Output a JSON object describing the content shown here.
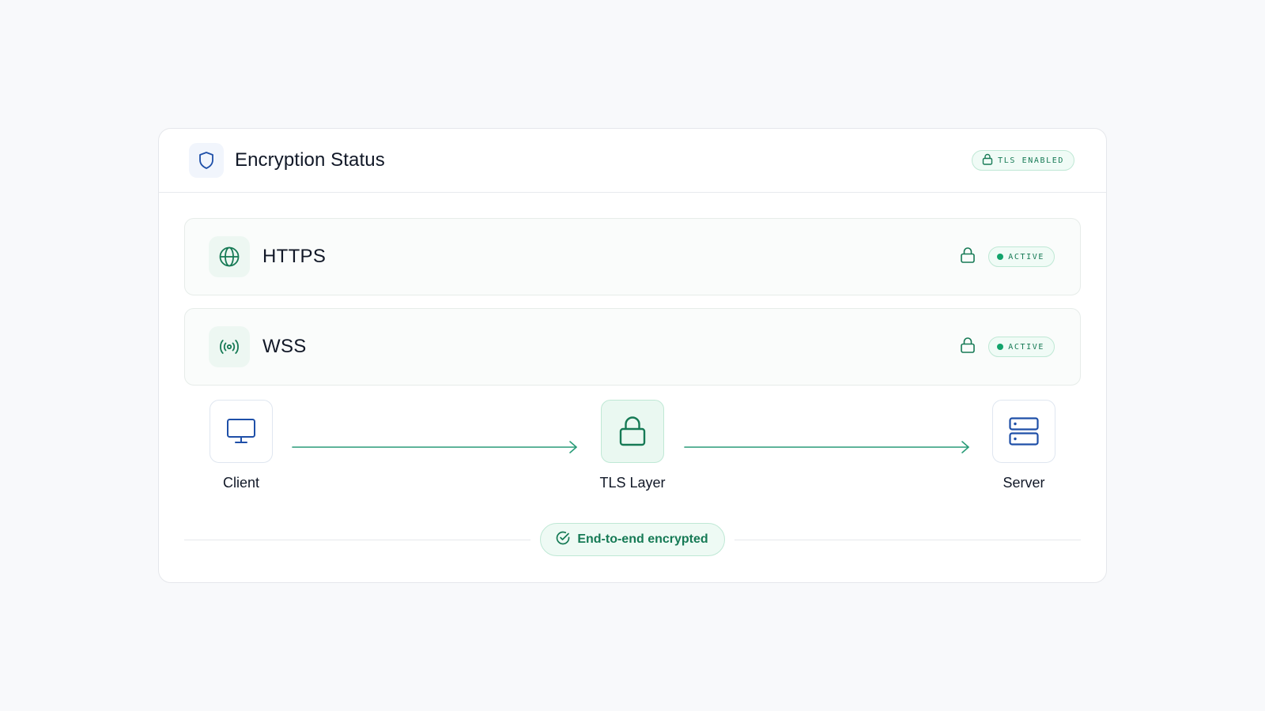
{
  "header": {
    "title": "Encryption Status",
    "icon": "shield-icon",
    "badge": {
      "label": "TLS ENABLED",
      "icon": "lock-icon"
    }
  },
  "protocols": [
    {
      "name": "HTTPS",
      "icon": "globe-icon",
      "status": "ACTIVE",
      "status_icon": "lock-icon"
    },
    {
      "name": "WSS",
      "icon": "broadcast-icon",
      "status": "ACTIVE",
      "status_icon": "lock-icon"
    }
  ],
  "flow": {
    "nodes": [
      {
        "label": "Client",
        "icon": "monitor-icon"
      },
      {
        "label": "TLS Layer",
        "icon": "lock-icon"
      },
      {
        "label": "Server",
        "icon": "server-icon"
      }
    ]
  },
  "footer": {
    "label": "End-to-end encrypted",
    "icon": "check-circle-icon"
  },
  "colors": {
    "accent_green": "#167a55",
    "status_dot": "#12a36b",
    "accent_blue": "#1e4fa8",
    "page_background": "#f8f9fb"
  }
}
